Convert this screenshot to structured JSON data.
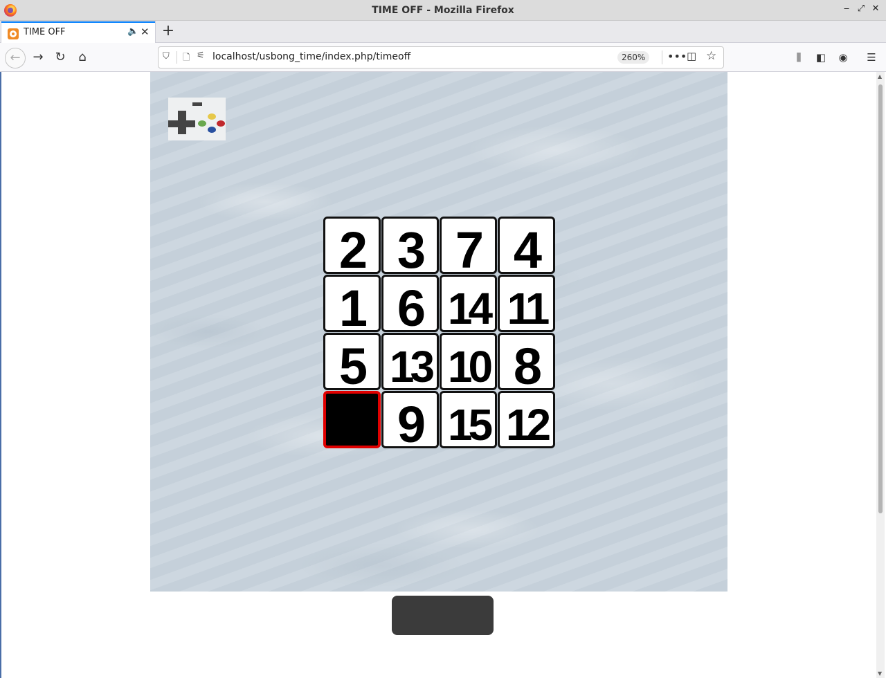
{
  "window": {
    "title": "TIME OFF - Mozilla Firefox",
    "controls": {
      "minimize": "‒",
      "maximize": "⤢",
      "close": "✕"
    }
  },
  "tab": {
    "label": "TIME OFF",
    "audio_icon": "🔈",
    "close_icon": "✕",
    "new_tab": "+"
  },
  "nav": {
    "back": "←",
    "forward": "→",
    "reload": "↻",
    "home": "⌂",
    "url": "localhost/usbong_time/index.php/timeoff",
    "zoom": "260%",
    "more": "•••",
    "pocket": "◫",
    "bookmark": "☆",
    "library": "⫼",
    "sidebar": "◧",
    "account": "◉",
    "menu": "☰"
  },
  "puzzle": {
    "rows": [
      [
        "2",
        "3",
        "7",
        "4"
      ],
      [
        "1",
        "6",
        "14",
        "11"
      ],
      [
        "5",
        "13",
        "10",
        "8"
      ],
      [
        "",
        "9",
        "15",
        "12"
      ]
    ],
    "empty_highlight_color": "#e00000"
  },
  "action_button": {
    "label": ""
  },
  "colors": {
    "tab_accent": "#0a84ff",
    "button": "#3b3b3b",
    "sand": "#c9d4dd"
  }
}
